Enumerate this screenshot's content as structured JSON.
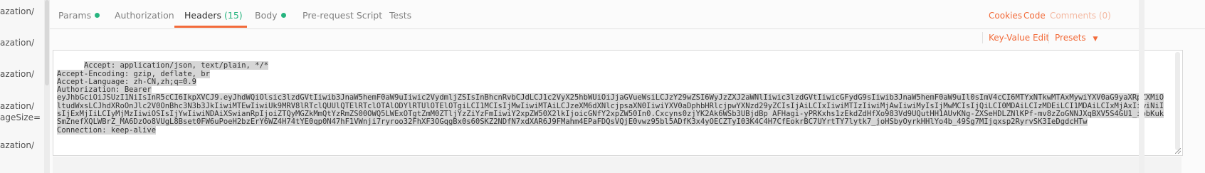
{
  "sidebar": {
    "items": [
      "azation/",
      "azation/",
      "azation/",
      "azation/",
      "ageSize=",
      "azation/"
    ]
  },
  "tabs": [
    {
      "label": "Params",
      "dot": true
    },
    {
      "label": "Authorization"
    },
    {
      "label": "Headers",
      "count": "(15)",
      "active": true
    },
    {
      "label": "Body",
      "dot": true
    },
    {
      "label": "Pre-request Script"
    },
    {
      "label": "Tests"
    }
  ],
  "right_links": {
    "cookies": "Cookies",
    "code": "Code",
    "comments": "Comments (0)"
  },
  "toolbar": {
    "key_value_edit": "Key-Value Edit",
    "presets": "Presets"
  },
  "headers_text": [
    "Accept: application/json, text/plain, */*",
    "Accept-Encoding: gzip, deflate, br",
    "Accept-Language: zh-CN,zh;q=0.9",
    "Authorization: Bearer",
    "eyJhbGciOiJSUzI1NiIsInR5cCI6IkpXVCJ9.eyJhdWQiOlsic3lzdGVtIiwib3JnaW5hemF0aW9uIiwic2VydmljZSIsInBhcnRvbCJdLCJ1c2VyX25hbWUiOiJjaGVueWsiLCJzY29wZSI6WyJzZXJ2aWNlIiwic3lzdGVtIiwicGFydG9sIiwib3JnaW5hemF0aW9uIl0sImV4cCI6MTYxNTkwMTAxMywiYXV0aG9yaXRpZXMiOltudWxsLCJhdXRoOnJlc2V0OnBhc3N3b3JkIiwiMTEwIiwiUk9MRV8lRTclQUUlQTElRTclOTAlODYlRTUlOTElOTgiLCI1MCIsIjMwIiwiMTAiLCJzeXM6dXNlcjpsaXN0IiwiYXV0aDphbHRlcjpwYXNzd29yZCIsIjAiLCIxIiwiMTIzIiwiMjAwIiwiMyIsIjMwMCIsIjQiLCI0MDAiLCIzMDEiLCI1MDAiLCIxMjAxIiwiNiIsIjExMjIiLCIyMjMzIiwiOSIsIjYwIiwiNDAiXSwianRpIjoiZTQyMGZkMmQtYzRmZS00OWQ5LWExOTgtZmM0ZTljYzZiYzFmIiwiY2xpZW50X2lkIjoicGNfY2xpZW50In0.Cxcyns0zjYK2Ak6WSb3UBjdBp_AFHagi-yPRKxhs1zEkdZdHfXo983Vd9UQutHH1AUvKNg-ZXSeHDLZNlKPf-mv8zZoGNNJXqBXV5S4GU1_ipbKukSmZnefXQLWBrZ_MA6DzOo8VUgL8Bset0FW6uPoeH2bzErY6WZ4H74tYE0qp0N47hF1VWnji7ryroo32FhXF3OGqgBx0s60SKZ2NDfN7xdXAR6J9FMahm4EPaFDQsVQjE0vwz95bl5ADfK3x4yOECZTyI03K4C4H7CfEokrBC7UYrtTY7lytk7_joHSbyOyrkHHlYo4b_49Sg7MIjqxsp2RyrvSK3IeDgdcHTw",
    "Connection: keep-alive"
  ]
}
